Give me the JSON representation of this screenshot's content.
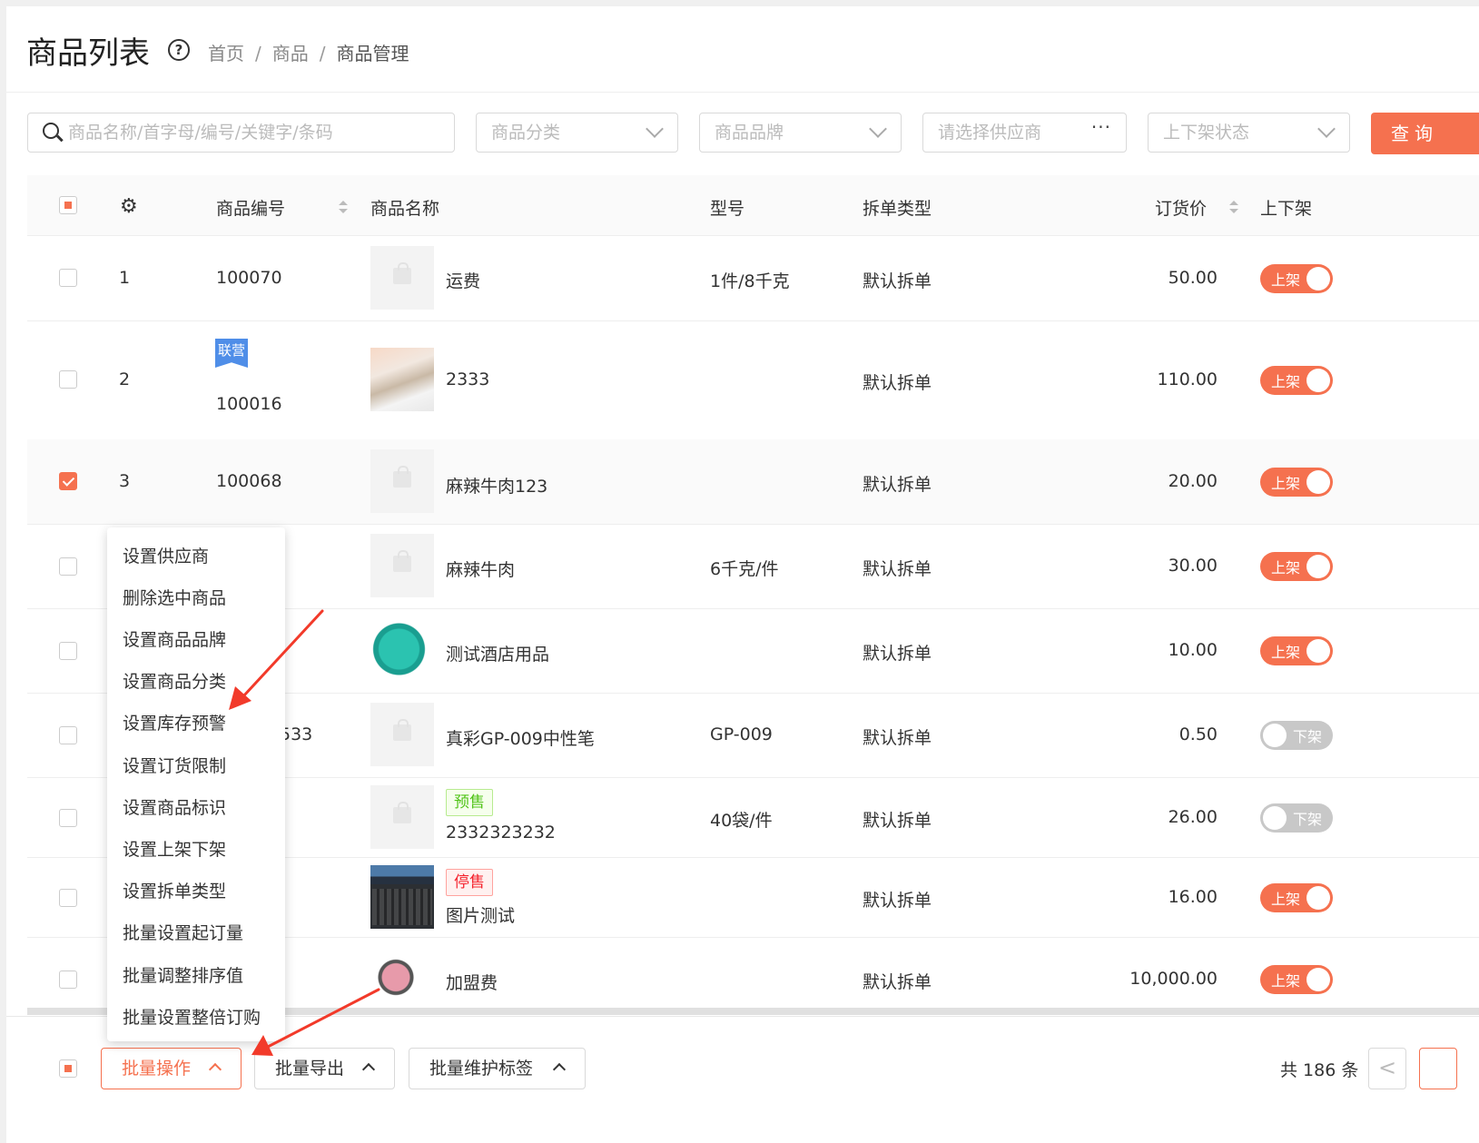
{
  "header": {
    "title": "商品列表",
    "help_icon": "?",
    "breadcrumb": [
      "首页",
      "商品",
      "商品管理"
    ],
    "separator": "/"
  },
  "filters": {
    "search_placeholder": "商品名称/首字母/编号/关键字/条码",
    "category_placeholder": "商品分类",
    "brand_placeholder": "商品品牌",
    "supplier_placeholder": "请选择供应商",
    "supplier_more": "···",
    "status_placeholder": "上下架状态",
    "query_button": "查询"
  },
  "table": {
    "columns": {
      "code": "商品编号",
      "name": "商品名称",
      "model": "型号",
      "split": "拆单类型",
      "price": "订货价",
      "shelf": "上下架"
    },
    "rows": [
      {
        "idx": "1",
        "code": "100070",
        "name": "运费",
        "model": "1件/8千克",
        "split": "默认拆单",
        "price": "50.00",
        "shelf": "上架",
        "on": true
      },
      {
        "idx": "2",
        "tag": "联营",
        "code": "100016",
        "name": "2333",
        "model": "",
        "split": "默认拆单",
        "price": "110.00",
        "shelf": "上架",
        "on": true
      },
      {
        "idx": "3",
        "code": "100068",
        "name": "麻辣牛肉123",
        "model": "",
        "split": "默认拆单",
        "price": "20.00",
        "shelf": "上架",
        "on": true,
        "checked": true
      },
      {
        "idx": "",
        "code": "",
        "name": "麻辣牛肉",
        "model": "6千克/件",
        "split": "默认拆单",
        "price": "30.00",
        "shelf": "上架",
        "on": true
      },
      {
        "idx": "",
        "code": "",
        "name": "测试酒店用品",
        "model": "",
        "split": "默认拆单",
        "price": "10.00",
        "shelf": "上架",
        "on": true
      },
      {
        "idx": "",
        "code": "533",
        "name": "真彩GP-009中性笔",
        "model": "GP-009",
        "split": "默认拆单",
        "price": "0.50",
        "shelf": "下架",
        "on": false
      },
      {
        "idx": "",
        "code": "",
        "badge": "预售",
        "name": "2332323232",
        "model": "40袋/件",
        "split": "默认拆单",
        "price": "26.00",
        "shelf": "下架",
        "on": false
      },
      {
        "idx": "",
        "code": "",
        "badge": "停售",
        "name": "图片测试",
        "model": "",
        "split": "默认拆单",
        "price": "16.00",
        "shelf": "上架",
        "on": true
      },
      {
        "idx": "",
        "code": "",
        "name": "加盟费",
        "model": "",
        "split": "默认拆单",
        "price": "10,000.00",
        "shelf": "上架",
        "on": true
      }
    ]
  },
  "batch_menu": [
    "设置供应商",
    "删除选中商品",
    "设置商品品牌",
    "设置商品分类",
    "设置库存预警",
    "设置订货限制",
    "设置商品标识",
    "设置上架下架",
    "设置拆单类型",
    "批量设置起订量",
    "批量调整排序值",
    "批量设置整倍订购"
  ],
  "footer": {
    "batch_ops": "批量操作",
    "batch_export": "批量导出",
    "batch_tags": "批量维护标签",
    "total": "共 186 条",
    "prev": "<"
  },
  "colors": {
    "accent": "#f5714f",
    "arrow": "#f23a2a"
  },
  "icons": [
    "search-icon",
    "chevron-down-icon",
    "gear-icon",
    "help-icon",
    "sort-icon",
    "chevron-up-icon"
  ]
}
